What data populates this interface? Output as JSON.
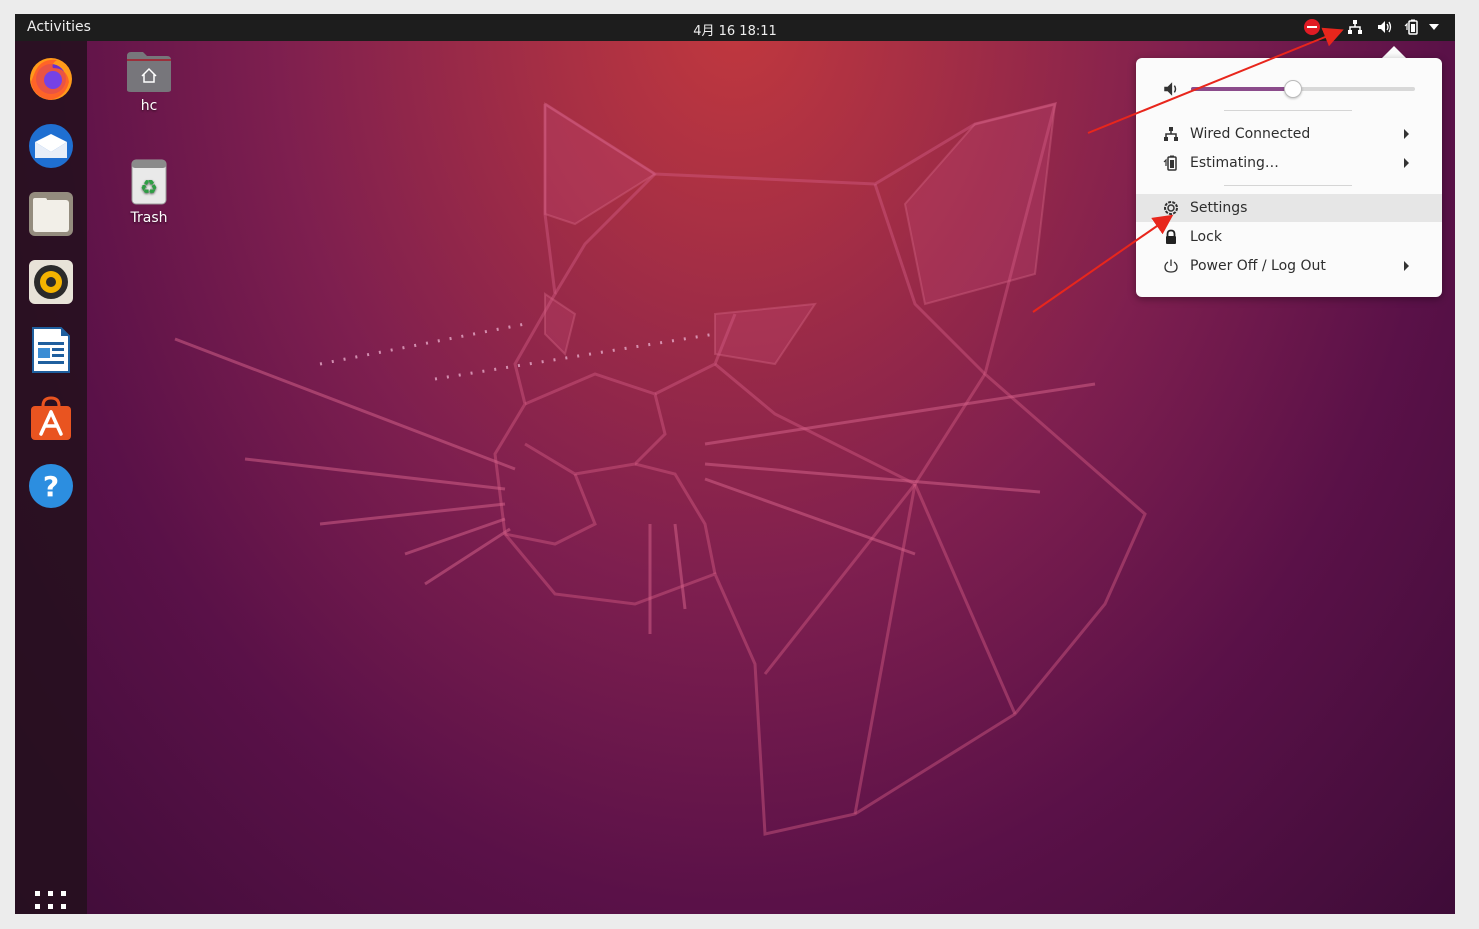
{
  "topbar": {
    "activities": "Activities",
    "clock": "4月 16  18:11",
    "tray_icons": [
      "do-not-disturb-icon",
      "network-wired-icon",
      "volume-icon",
      "battery-icon",
      "dropdown-arrow-icon"
    ]
  },
  "dock": {
    "items": [
      {
        "name": "Firefox",
        "icon": "firefox-icon"
      },
      {
        "name": "Thunderbird",
        "icon": "thunderbird-icon"
      },
      {
        "name": "Files",
        "icon": "files-icon"
      },
      {
        "name": "Rhythmbox",
        "icon": "rhythmbox-icon"
      },
      {
        "name": "LibreOffice Writer",
        "icon": "writer-icon"
      },
      {
        "name": "Ubuntu Software",
        "icon": "software-icon"
      },
      {
        "name": "Help",
        "icon": "help-icon"
      }
    ],
    "show_apps_icon": "apps-grid-icon"
  },
  "desktop": {
    "icons": [
      {
        "label": "hc",
        "icon": "home-folder-icon"
      },
      {
        "label": "Trash",
        "icon": "trash-icon"
      }
    ]
  },
  "system_menu": {
    "volume_level": 0.45,
    "items": [
      {
        "label": "Wired Connected",
        "icon": "network-wired-icon",
        "submenu": true
      },
      {
        "label": "Estimating…",
        "icon": "battery-icon",
        "submenu": true
      },
      {
        "label": "Settings",
        "icon": "settings-icon",
        "submenu": false,
        "highlighted": true
      },
      {
        "label": "Lock",
        "icon": "lock-icon",
        "submenu": false
      },
      {
        "label": "Power Off / Log Out",
        "icon": "power-icon",
        "submenu": true
      }
    ]
  },
  "colors": {
    "accent": "#8b4b8b",
    "annotation_arrow": "#e8261c",
    "topbar": "#1d1d1d",
    "highlight_row": "#e6e6e6"
  }
}
